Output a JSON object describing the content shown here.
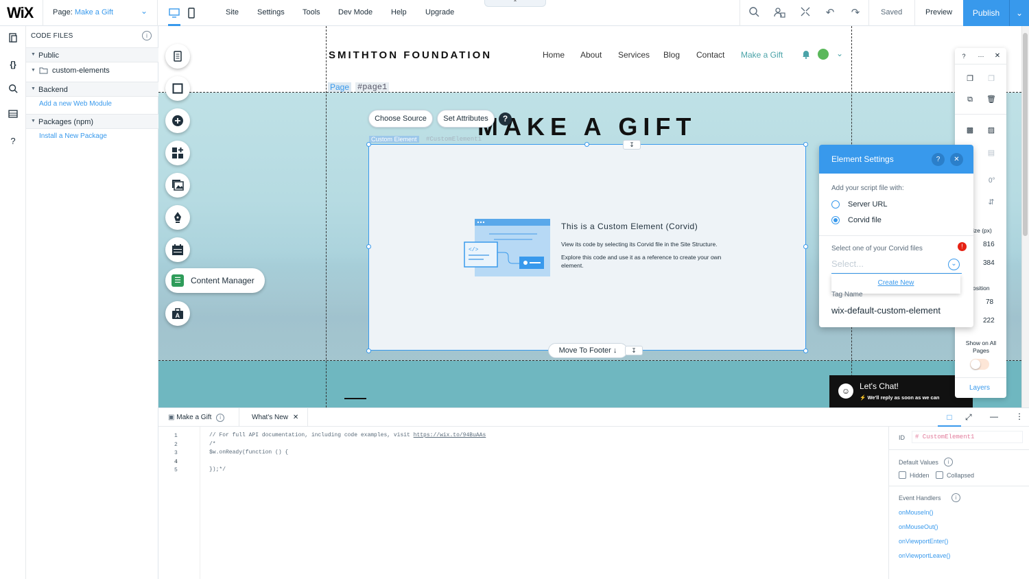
{
  "topbar": {
    "logo": "WiX",
    "page_label": "Page:",
    "page_name": "Make a Gift",
    "menu": [
      "Site",
      "Settings",
      "Tools",
      "Dev Mode",
      "Help",
      "Upgrade"
    ],
    "saved": "Saved",
    "preview": "Preview",
    "publish": "Publish"
  },
  "codepanel": {
    "title": "CODE FILES",
    "public": "Public",
    "folder": "custom-elements",
    "backend": "Backend",
    "add_module": "Add a new Web Module",
    "packages": "Packages (npm)",
    "install_pkg": "Install a New Package"
  },
  "site": {
    "logo": "SMITHTON FOUNDATION",
    "nav": [
      "Home",
      "About",
      "Services",
      "Blog",
      "Contact",
      "Make a Gift"
    ],
    "page_tag": "Page",
    "page_id": "#page1",
    "heading": "MAKE A GIFT",
    "choose_source": "Choose Source",
    "set_attributes": "Set Attributes",
    "ce_label": "Custom Element",
    "ce_id": "#CustomElement1",
    "ce_title": "This is a Custom Element (Corvid)",
    "ce_desc1": "View its code by selecting its Corvid file in the Site Structure.",
    "ce_desc2": "Explore this code and use it as a reference to create your own element.",
    "content_manager": "Content Manager",
    "move_to_footer": "Move To Footer",
    "chat_title": "Let's Chat!",
    "chat_sub": "We'll reply as soon as we can"
  },
  "settings": {
    "title": "Element Settings",
    "add_script": "Add your script file with:",
    "server_url": "Server URL",
    "corvid_file": "Corvid file",
    "select_label": "Select one of your Corvid files",
    "select_placeholder": "Select...",
    "create_new": "Create New",
    "tag_name_label": "Tag Name",
    "tag_name_value": "wix-default-custom-element"
  },
  "rtool": {
    "rotation": "0°",
    "size_label": "ize (px)",
    "width": "816",
    "height": "384",
    "position_label": "osition",
    "x": "78",
    "y": "222",
    "show_all": "Show on All Pages",
    "layers": "Layers"
  },
  "editor": {
    "tab1": "Make a Gift",
    "tab2": "What's New",
    "lines": [
      "1",
      "2",
      "3",
      "4",
      "5"
    ],
    "code1": "// For full API documentation, including code examples, visit ",
    "code1_link": "https://wix.to/94BuAAs",
    "code2": "/*",
    "code3": "$w.onReady(function () {",
    "code4": "",
    "code5": "});*/",
    "id_label": "ID",
    "id_value": "# CustomElement1",
    "default_values": "Default Values",
    "hidden": "Hidden",
    "collapsed": "Collapsed",
    "event_handlers": "Event Handlers",
    "handlers": [
      "onMouseIn()",
      "onMouseOut()",
      "onViewportEnter()",
      "onViewportLeave()"
    ]
  }
}
